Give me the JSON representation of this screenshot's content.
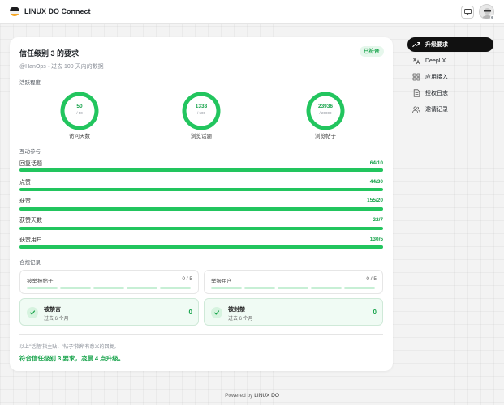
{
  "header": {
    "title": "LINUX DO Connect"
  },
  "card": {
    "title": "信任级别 3 的要求",
    "badge": "已符合",
    "subtitle": "@HanOps · 过去 100 天内的数据"
  },
  "activity": {
    "label": "活跃程度",
    "rings": [
      {
        "value": "50",
        "target": "/ 50",
        "label": "访问天数",
        "progress": 1.0
      },
      {
        "value": "1333",
        "target": "/ 500",
        "label": "浏览话题",
        "progress": 1.0
      },
      {
        "value": "23936",
        "target": "/ 20000",
        "label": "浏览帖子",
        "progress": 1.0
      }
    ]
  },
  "interaction": {
    "label": "互动参与",
    "bars": [
      {
        "label": "回复话题",
        "value": "64/10",
        "progress": 1.0
      },
      {
        "label": "点赞",
        "value": "44/30",
        "progress": 1.0
      },
      {
        "label": "获赞",
        "value": "155/20",
        "progress": 1.0
      },
      {
        "label": "获赞天数",
        "value": "22/7",
        "progress": 1.0
      },
      {
        "label": "获赞用户",
        "value": "130/5",
        "progress": 1.0
      }
    ]
  },
  "compliance": {
    "label": "合规记录",
    "flagged_posts": {
      "label": "被举报帖子",
      "count": "0 / 5"
    },
    "flagged_users": {
      "label": "举报用户",
      "count": "0 / 5"
    },
    "silenced": {
      "title": "被禁言",
      "sub": "过去 6 个月",
      "value": "0"
    },
    "suspended": {
      "title": "被封禁",
      "sub": "过去 6 个月",
      "value": "0"
    }
  },
  "note": "以上\"话题\"指主贴，\"帖子\"指所有意义的回复。",
  "result": "符合信任级别 3 要求，凌晨 4 点升级。",
  "sidebar": {
    "items": [
      {
        "label": "升级要求",
        "icon": "trending-up-icon",
        "active": true
      },
      {
        "label": "DeepLX",
        "icon": "translate-icon",
        "active": false
      },
      {
        "label": "应用接入",
        "icon": "grid-icon",
        "active": false
      },
      {
        "label": "授权日志",
        "icon": "document-icon",
        "active": false
      },
      {
        "label": "邀请记录",
        "icon": "users-icon",
        "active": false
      }
    ]
  },
  "footer": {
    "prefix": "Powered by",
    "brand": "LINUX DO"
  },
  "colors": {
    "accent": "#22c55e",
    "accent_text": "#16a34a",
    "active_bg": "#111111"
  }
}
